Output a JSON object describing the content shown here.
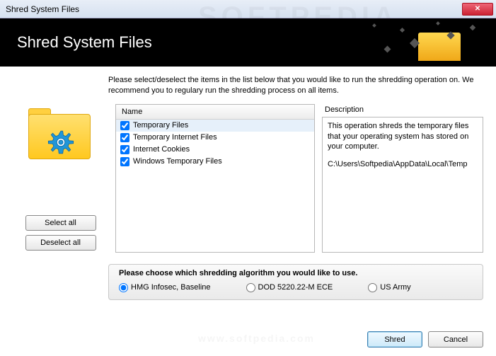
{
  "window": {
    "title": "Shred System Files"
  },
  "header": {
    "title": "Shred System Files"
  },
  "instruction": "Please select/deselect the items in the list below that you would like to run the shredding operation on. We recommend you to regulary run the shredding process on all items.",
  "list": {
    "header": "Name",
    "items": [
      {
        "label": "Temporary Files",
        "checked": true,
        "selected": true
      },
      {
        "label": "Temporary Internet Files",
        "checked": true,
        "selected": false
      },
      {
        "label": "Internet Cookies",
        "checked": true,
        "selected": false
      },
      {
        "label": "Windows Temporary Files",
        "checked": true,
        "selected": false
      }
    ]
  },
  "description": {
    "header": "Description",
    "text": "This operation shreds the temporary files that your operating system has stored on your computer.",
    "path": "C:\\Users\\Softpedia\\AppData\\Local\\Temp"
  },
  "sidebar": {
    "select_all": "Select all",
    "deselect_all": "Deselect all"
  },
  "algo": {
    "title": "Please choose which shredding algorithm you would like to use.",
    "options": [
      {
        "label": "HMG Infosec, Baseline",
        "checked": true
      },
      {
        "label": "DOD 5220.22-M ECE",
        "checked": false
      },
      {
        "label": "US Army",
        "checked": false
      }
    ]
  },
  "footer": {
    "shred": "Shred",
    "cancel": "Cancel"
  },
  "watermark": "SOFTPEDIA"
}
